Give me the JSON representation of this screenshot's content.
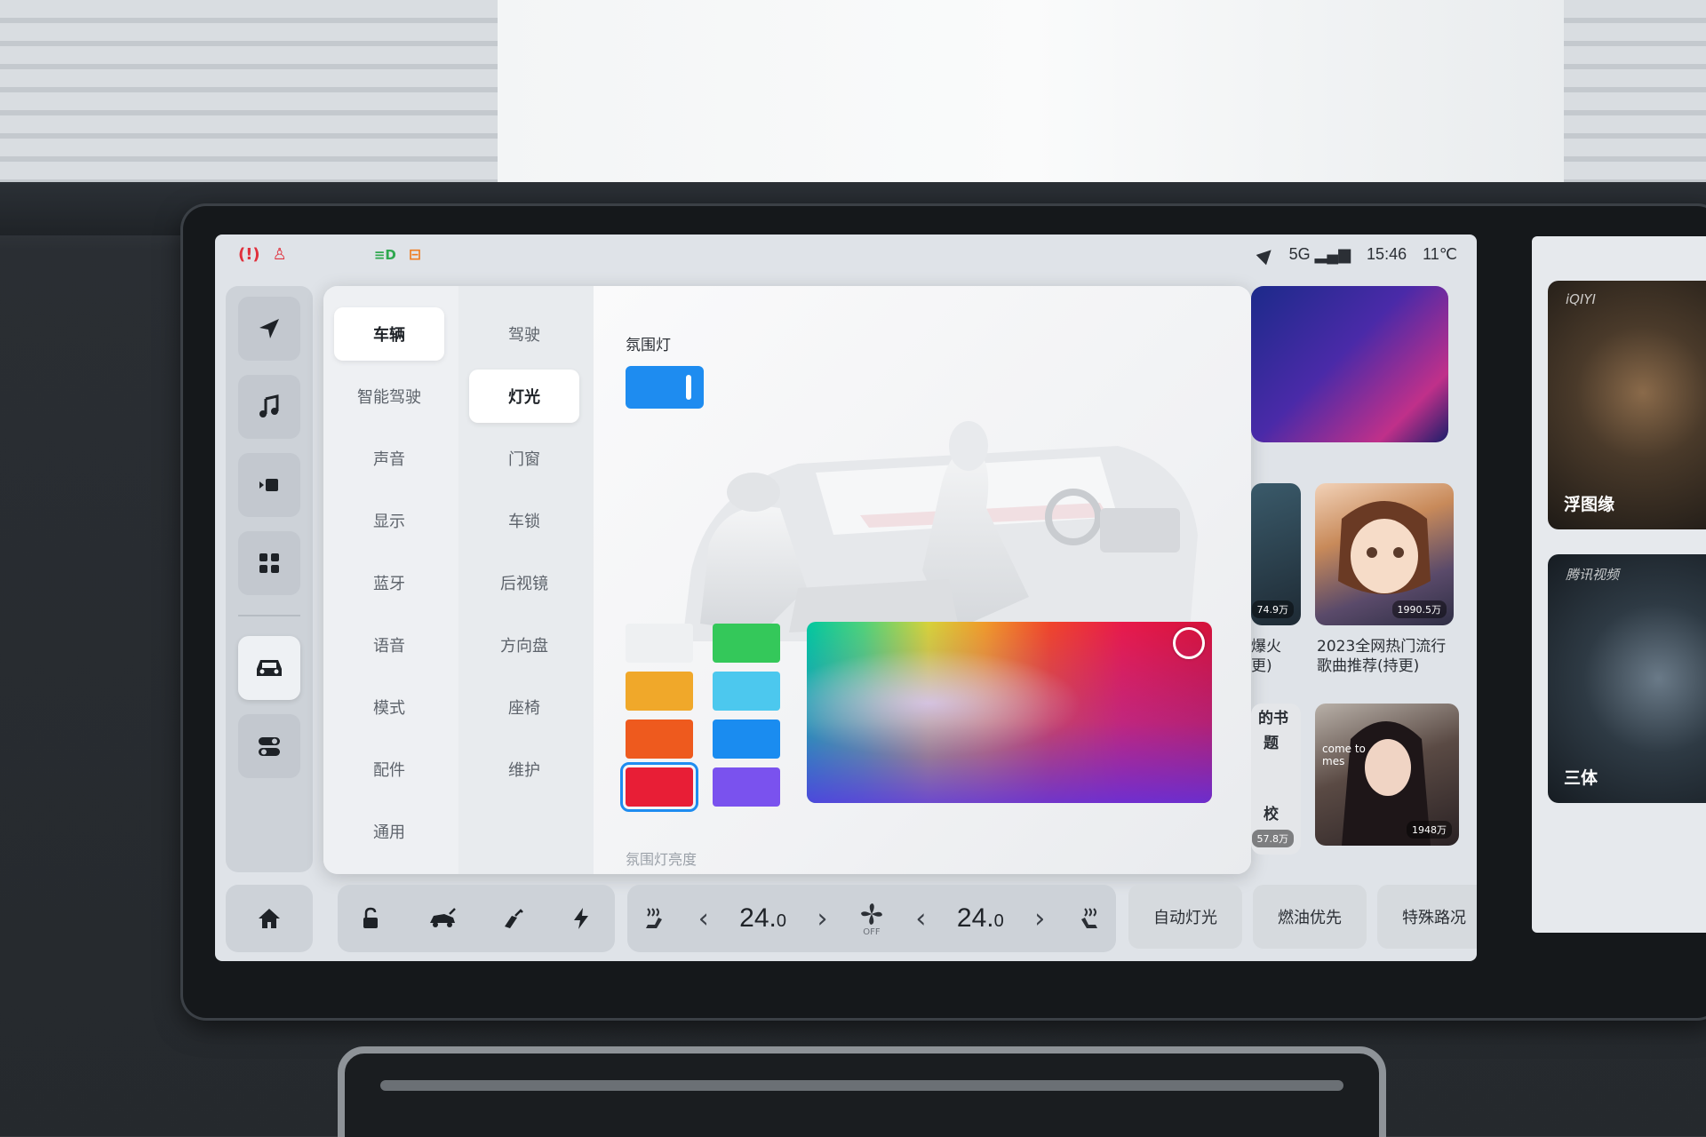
{
  "status_bar": {
    "network": "5G",
    "time": "15:46",
    "temperature": "11℃",
    "warning_icons": [
      "tire-pressure-warning-icon",
      "seatbelt-warning-icon",
      "lights-icon",
      "engine-icon"
    ]
  },
  "nav_rail": {
    "items": [
      "navigation-icon",
      "music-icon",
      "video-icon",
      "apps-icon",
      "vehicle-icon",
      "controls-icon"
    ],
    "active": "vehicle-icon"
  },
  "settings": {
    "primary_menu": [
      "车辆",
      "智能驾驶",
      "声音",
      "显示",
      "蓝牙",
      "语音",
      "模式",
      "配件",
      "通用"
    ],
    "secondary_menu": [
      "驾驶",
      "灯光",
      "门窗",
      "车锁",
      "后视镜",
      "方向盘",
      "座椅",
      "维护"
    ],
    "ambient_title": "氛围灯",
    "ambient_enabled": true,
    "brightness_label": "氛围灯亮度",
    "swatches": [
      {
        "name": "white",
        "color": "#eef0f2"
      },
      {
        "name": "green",
        "color": "#34c85a"
      },
      {
        "name": "amber",
        "color": "#f0a82a"
      },
      {
        "name": "cyan",
        "color": "#4cc8ee"
      },
      {
        "name": "orange",
        "color": "#ee5a1e"
      },
      {
        "name": "blue",
        "color": "#1a8cf0"
      },
      {
        "name": "red",
        "color": "#e81e36"
      },
      {
        "name": "purple",
        "color": "#7a52ee"
      }
    ],
    "selected_swatch": "red"
  },
  "media": {
    "card_1_count": "74.9万",
    "card_2_count": "1990.5万",
    "card_2_caption_line1": "2023全网热门流行",
    "card_2_caption_line2": "歌曲推荐(持更)",
    "card_1_caption_line1": "爆火",
    "card_1_caption_line2": "更)",
    "card_3_caption_line1": "的书",
    "card_3_caption_line2": "题",
    "card_3_caption_line3": "校",
    "card_3_count": "57.8万",
    "card_4_count": "1948万",
    "card_4_overlay": "come to\nmes"
  },
  "dock": {
    "left_temp": "24.",
    "left_temp_decimal": "0",
    "right_temp": "24.",
    "right_temp_decimal": "0",
    "fan_state": "OFF",
    "quick_buttons": [
      "自动灯光",
      "燃油优先",
      "特殊路况"
    ]
  },
  "side_screen": {
    "card_1_brand": "iQIYI",
    "card_1_title": "浮图缘",
    "card_2_brand": "腾讯视频",
    "card_2_title": "三体"
  }
}
